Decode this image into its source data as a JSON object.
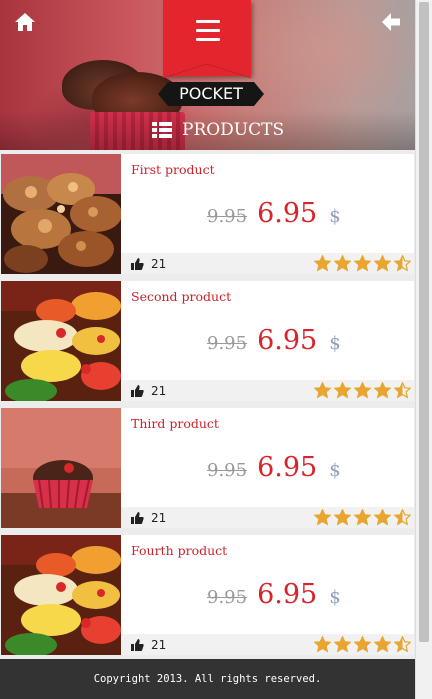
{
  "header": {
    "logo_text": "POCKET",
    "section_title": "PRODUCTS",
    "icons": {
      "home": "home-icon",
      "back": "arrow-left-icon",
      "menu": "hamburger-menu-icon",
      "section": "list-icon"
    },
    "colors": {
      "ribbon": "#e3262d",
      "logo_bg": "#151515"
    }
  },
  "products": [
    {
      "title": "First product",
      "old_price": "9.95",
      "new_price": "6.95",
      "currency": "$",
      "likes": "21",
      "rating": 4.5
    },
    {
      "title": "Second product",
      "old_price": "9.95",
      "new_price": "6.95",
      "currency": "$",
      "likes": "21",
      "rating": 4.5
    },
    {
      "title": "Third product",
      "old_price": "9.95",
      "new_price": "6.95",
      "currency": "$",
      "likes": "21",
      "rating": 4.5
    },
    {
      "title": "Fourth product",
      "old_price": "9.95",
      "new_price": "6.95",
      "currency": "$",
      "likes": "21",
      "rating": 4.5
    }
  ],
  "colors": {
    "title": "#c8232b",
    "price": "#d8242b",
    "star": "#e8a531",
    "footer_bg": "#333333"
  },
  "footer": {
    "copyright": "Copyright 2013. All rights reserved."
  }
}
